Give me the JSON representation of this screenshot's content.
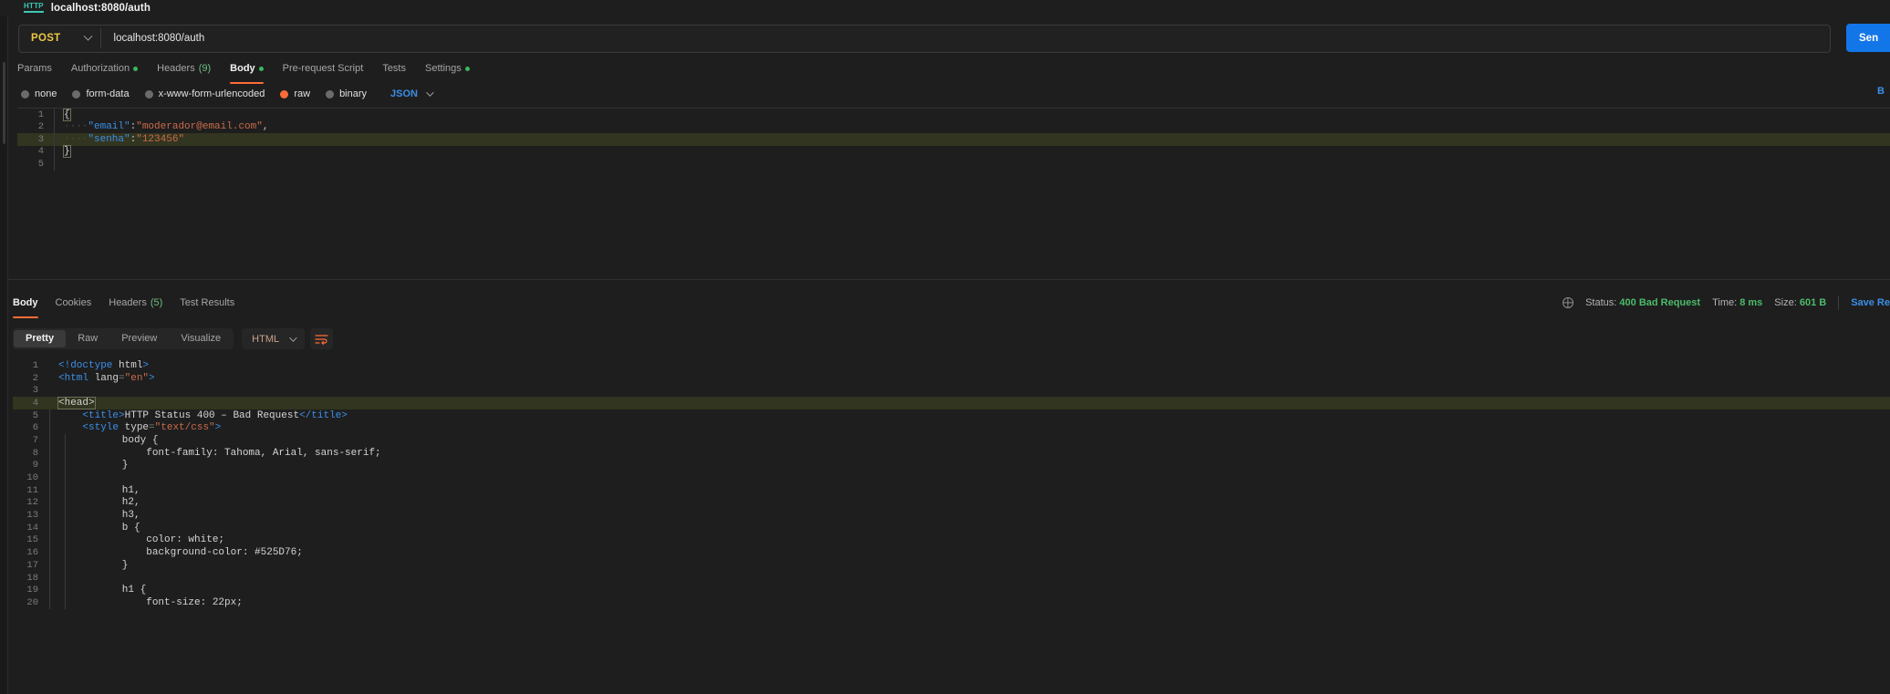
{
  "titlebar": {
    "icon": "http-icon",
    "title": "localhost:8080/auth"
  },
  "request": {
    "method": "POST",
    "url": "localhost:8080/auth",
    "send_label": "Sen",
    "tabs": [
      {
        "label": "Params",
        "active": false,
        "dot": false,
        "count": ""
      },
      {
        "label": "Authorization",
        "active": false,
        "dot": true,
        "count": ""
      },
      {
        "label": "Headers",
        "active": false,
        "dot": false,
        "count": "(9)"
      },
      {
        "label": "Body",
        "active": true,
        "dot": true,
        "count": ""
      },
      {
        "label": "Pre-request Script",
        "active": false,
        "dot": false,
        "count": ""
      },
      {
        "label": "Tests",
        "active": false,
        "dot": false,
        "count": ""
      },
      {
        "label": "Settings",
        "active": false,
        "dot": true,
        "count": ""
      }
    ],
    "body_types": [
      {
        "label": "none",
        "selected": false
      },
      {
        "label": "form-data",
        "selected": false
      },
      {
        "label": "x-www-form-urlencoded",
        "selected": false
      },
      {
        "label": "raw",
        "selected": true
      },
      {
        "label": "binary",
        "selected": false
      }
    ],
    "format": "JSON",
    "beautify_label": "B",
    "code": [
      {
        "n": "1",
        "segs": [
          {
            "t": "{",
            "c": "brace"
          }
        ]
      },
      {
        "n": "2",
        "segs": [
          {
            "t": "····",
            "c": "ind"
          },
          {
            "t": "\"email\"",
            "c": "key"
          },
          {
            "t": ":",
            "c": "pun"
          },
          {
            "t": "\"moderador@email.com\"",
            "c": "str"
          },
          {
            "t": ",",
            "c": "pun"
          }
        ]
      },
      {
        "n": "3",
        "hl": true,
        "segs": [
          {
            "t": "····",
            "c": "ind"
          },
          {
            "t": "\"senha\"",
            "c": "key"
          },
          {
            "t": ":",
            "c": "pun"
          },
          {
            "t": "\"123456\"",
            "c": "str"
          }
        ]
      },
      {
        "n": "4",
        "segs": [
          {
            "t": "}",
            "c": "brace"
          }
        ]
      },
      {
        "n": "5",
        "segs": []
      }
    ]
  },
  "response": {
    "tabs": [
      {
        "label": "Body",
        "active": true,
        "count": ""
      },
      {
        "label": "Cookies",
        "active": false,
        "count": ""
      },
      {
        "label": "Headers",
        "active": false,
        "count": "(5)"
      },
      {
        "label": "Test Results",
        "active": false,
        "count": ""
      }
    ],
    "status_label": "Status:",
    "status_value": "400 Bad Request",
    "time_label": "Time:",
    "time_value": "8 ms",
    "size_label": "Size:",
    "size_value": "601 B",
    "save_label": "Save Re",
    "view_modes": [
      {
        "label": "Pretty",
        "active": true
      },
      {
        "label": "Raw",
        "active": false
      },
      {
        "label": "Preview",
        "active": false
      },
      {
        "label": "Visualize",
        "active": false
      }
    ],
    "format": "HTML",
    "code": [
      {
        "n": "1",
        "ind": 0,
        "segs": [
          {
            "t": "<!doctype ",
            "c": "tag"
          },
          {
            "t": "html",
            "c": "txt"
          },
          {
            "t": ">",
            "c": "tag"
          }
        ]
      },
      {
        "n": "2",
        "ind": 0,
        "segs": [
          {
            "t": "<html ",
            "c": "tag"
          },
          {
            "t": "lang",
            "c": "txt"
          },
          {
            "t": "=",
            "c": "brk"
          },
          {
            "t": "\"en\"",
            "c": "val"
          },
          {
            "t": ">",
            "c": "tag"
          }
        ]
      },
      {
        "n": "3",
        "ind": 0,
        "segs": []
      },
      {
        "n": "4",
        "ind": 0,
        "hl": true,
        "segs": [
          {
            "t": "<head>",
            "c": "tagbox"
          }
        ]
      },
      {
        "n": "5",
        "ind": 1,
        "segs": [
          {
            "t": "    <title>",
            "c": "tag"
          },
          {
            "t": "HTTP Status 400 – Bad Request",
            "c": "txt"
          },
          {
            "t": "</title>",
            "c": "tag"
          }
        ]
      },
      {
        "n": "6",
        "ind": 1,
        "segs": [
          {
            "t": "    <style ",
            "c": "tag"
          },
          {
            "t": "type",
            "c": "txt"
          },
          {
            "t": "=",
            "c": "brk"
          },
          {
            "t": "\"text/css\"",
            "c": "val"
          },
          {
            "t": ">",
            "c": "tag"
          }
        ]
      },
      {
        "n": "7",
        "ind": 2,
        "segs": [
          {
            "t": "        body {",
            "c": "txt"
          }
        ]
      },
      {
        "n": "8",
        "ind": 3,
        "segs": [
          {
            "t": "            font-family: Tahoma, Arial, sans-serif;",
            "c": "txt"
          }
        ]
      },
      {
        "n": "9",
        "ind": 2,
        "segs": [
          {
            "t": "        }",
            "c": "txt"
          }
        ]
      },
      {
        "n": "10",
        "ind": 2,
        "segs": []
      },
      {
        "n": "11",
        "ind": 2,
        "segs": [
          {
            "t": "        h1,",
            "c": "txt"
          }
        ]
      },
      {
        "n": "12",
        "ind": 2,
        "segs": [
          {
            "t": "        h2,",
            "c": "txt"
          }
        ]
      },
      {
        "n": "13",
        "ind": 2,
        "segs": [
          {
            "t": "        h3,",
            "c": "txt"
          }
        ]
      },
      {
        "n": "14",
        "ind": 2,
        "segs": [
          {
            "t": "        b {",
            "c": "txt"
          }
        ]
      },
      {
        "n": "15",
        "ind": 3,
        "segs": [
          {
            "t": "            color: white;",
            "c": "txt"
          }
        ]
      },
      {
        "n": "16",
        "ind": 3,
        "segs": [
          {
            "t": "            background-color: #525D76;",
            "c": "txt"
          }
        ]
      },
      {
        "n": "17",
        "ind": 2,
        "segs": [
          {
            "t": "        }",
            "c": "txt"
          }
        ]
      },
      {
        "n": "18",
        "ind": 2,
        "segs": []
      },
      {
        "n": "19",
        "ind": 2,
        "segs": [
          {
            "t": "        h1 {",
            "c": "txt"
          }
        ]
      },
      {
        "n": "20",
        "ind": 3,
        "segs": [
          {
            "t": "            font-size: 22px;",
            "c": "txt"
          }
        ]
      }
    ]
  },
  "colors": {
    "accent": "#ff6c37",
    "send": "#1376e8",
    "method": "#eec643",
    "success": "#4cbb6b",
    "link": "#3b8fe8",
    "background": "#1e1e1e"
  }
}
